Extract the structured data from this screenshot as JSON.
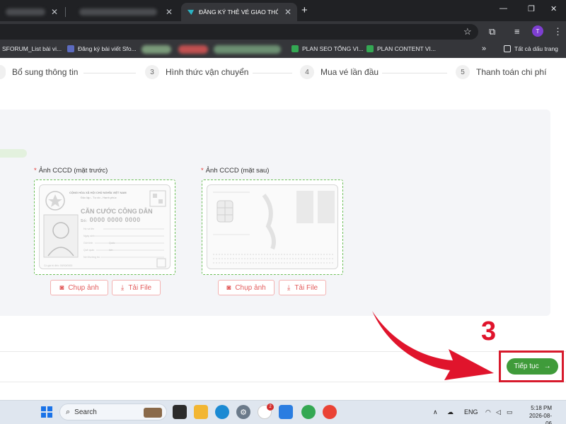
{
  "browser": {
    "active_tab_title": "ĐĂNG KÝ THẺ VÉ GIAO THÔNG",
    "bookmarks": [
      "SFORUM_List bài vi...",
      "Đăng ký bài viết Sfo...",
      "PLAN SEO TỔNG VI...",
      "PLAN CONTENT VI..."
    ],
    "all_bookmarks": "Tất cả dấu trang",
    "profile_initial": "T"
  },
  "steps": [
    {
      "num": "",
      "label": "Bổ sung thông tin"
    },
    {
      "num": "3",
      "label": "Hình thức vận chuyển"
    },
    {
      "num": "4",
      "label": "Mua vé lần đầu"
    },
    {
      "num": "5",
      "label": "Thanh toán chi phí"
    }
  ],
  "uploads": [
    {
      "label": "Ảnh CCCD (mặt trước)",
      "photo_btn": "Chụp ảnh",
      "file_btn": "Tải File"
    },
    {
      "label": "Ảnh CCCD (mặt sau)",
      "photo_btn": "Chụp ảnh",
      "file_btn": "Tải File"
    }
  ],
  "card_front": {
    "header_line1": "CỘNG HÒA XÃ HỘI CHỦ NGHĨA VIỆT NAM",
    "header_line2": "Độc lập - Tự do - Hạnh phúc",
    "title": "CĂN CƯỚC CÔNG DÂN",
    "number_prefix": "Số:",
    "number": "0000 0000 0000",
    "fields": [
      "Họ và tên",
      "Ngày sinh",
      "Giới tính",
      "Quốc tịch",
      "Quê quán",
      "Nơi thường trú"
    ],
    "expiry": "Có giá trị đến: 00/00/0000"
  },
  "annotation_number": "3",
  "next_button": "Tiếp tục",
  "next_arrow": "→",
  "required_mark": "*",
  "taskbar": {
    "search_placeholder": "Search",
    "lang": "ENG",
    "time": "5:18 PM",
    "date": "2026-08-06",
    "badge_mail": "2"
  }
}
